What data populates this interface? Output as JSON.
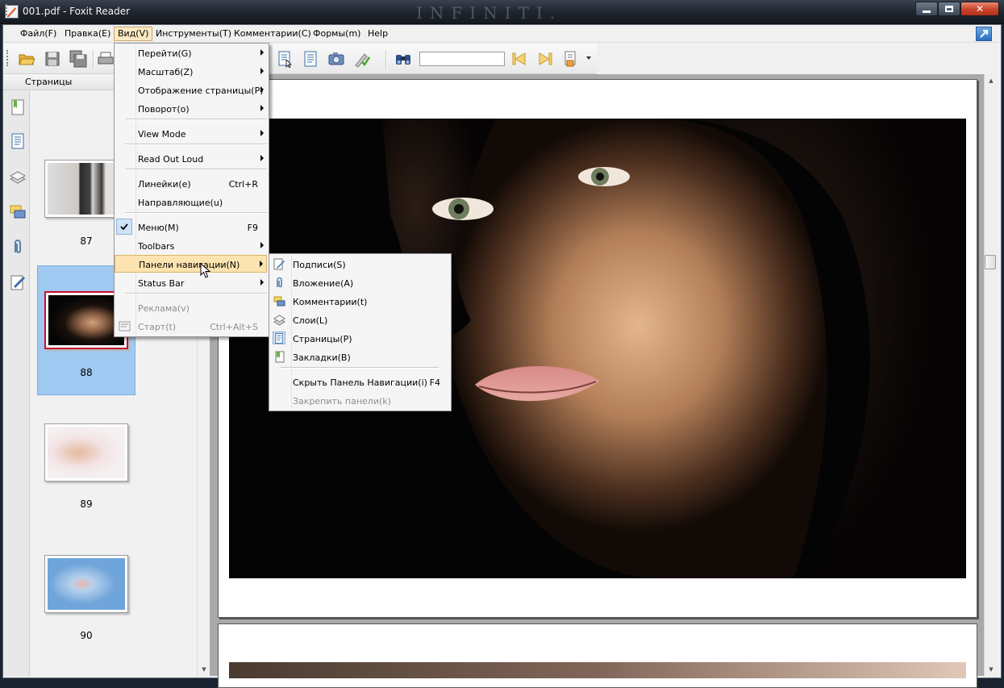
{
  "window": {
    "title": "001.pdf - Foxit Reader",
    "watermark": "INFINITI."
  },
  "menubar": {
    "items": [
      "Файл(F)",
      "Правка(E)",
      "Вид(V)",
      "Инструменты(T)",
      "Комментарии(C)",
      "Формы(m)",
      "Help"
    ],
    "active": "Вид(V)"
  },
  "toolbar": {
    "search_value": ""
  },
  "nav_panel": {
    "title": "Страницы",
    "thumbnails": [
      {
        "page": "87"
      },
      {
        "page": "88",
        "selected": true
      },
      {
        "page": "89"
      },
      {
        "page": "90"
      }
    ]
  },
  "view_menu": {
    "items": [
      {
        "label": "Перейти(G)",
        "submenu": true
      },
      {
        "label": "Масштаб(Z)",
        "submenu": true
      },
      {
        "label": "Отображение страницы(P)",
        "submenu": true
      },
      {
        "label": "Поворот(o)",
        "submenu": true
      },
      {
        "label": "View Mode",
        "submenu": true
      },
      {
        "label": "Read Out Loud",
        "submenu": true
      },
      {
        "label": "Линейки(e)",
        "shortcut": "Ctrl+R"
      },
      {
        "label": "Направляющие(u)"
      },
      {
        "label": "Меню(M)",
        "shortcut": "F9",
        "checked": true
      },
      {
        "label": "Toolbars",
        "submenu": true
      },
      {
        "label": "Панели навигации(N)",
        "submenu": true,
        "highlighted": true
      },
      {
        "label": "Status Bar",
        "submenu": true
      },
      {
        "label": "Реклама(v)",
        "disabled": true
      },
      {
        "label": "Старт(t)",
        "shortcut": "Ctrl+Alt+S",
        "disabled": true
      }
    ]
  },
  "nav_submenu": {
    "items": [
      {
        "label": "Подписи(S)",
        "icon": "signature-icon"
      },
      {
        "label": "Вложение(A)",
        "icon": "paperclip-icon"
      },
      {
        "label": "Комментарии(t)",
        "icon": "comments-icon"
      },
      {
        "label": "Слои(L)",
        "icon": "layers-icon"
      },
      {
        "label": "Страницы(P)",
        "icon": "pages-icon"
      },
      {
        "label": "Закладки(B)",
        "icon": "bookmark-icon"
      },
      {
        "label": "Скрыть Панель Навигации(i)",
        "shortcut": "F4"
      },
      {
        "label": "Закрепить панели(k)",
        "disabled": true
      }
    ]
  },
  "colors": {
    "menu_highlight": "#fce4b0",
    "selection": "#9fc9f0"
  }
}
